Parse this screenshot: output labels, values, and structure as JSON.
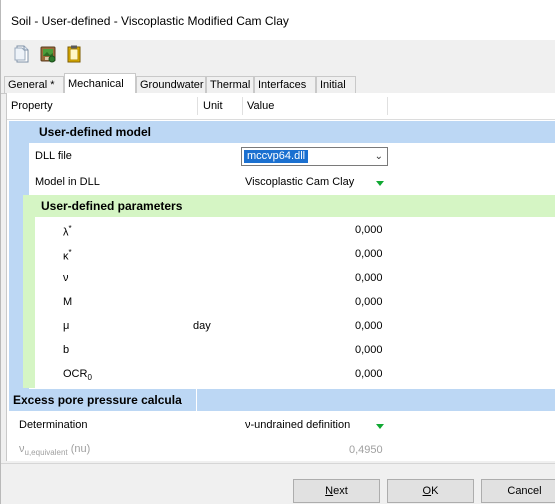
{
  "window": {
    "title": "Soil - User-defined - Viscoplastic Modified Cam Clay"
  },
  "toolbar": {
    "icons": [
      "new-document-icon",
      "save-image-icon",
      "clipboard-icon"
    ]
  },
  "tabs": [
    {
      "label": "General *",
      "active": false
    },
    {
      "label": "Mechanical",
      "active": true
    },
    {
      "label": "Groundwater",
      "active": false
    },
    {
      "label": "Thermal",
      "active": false
    },
    {
      "label": "Interfaces",
      "active": false
    },
    {
      "label": "Initial",
      "active": false
    }
  ],
  "table": {
    "headers": {
      "property": "Property",
      "unit": "Unit",
      "value": "Value"
    },
    "section_user_model": "User-defined model",
    "dll_file": {
      "label": "DLL file",
      "value": "mccvp64.dll"
    },
    "model_in_dll": {
      "label": "Model in DLL",
      "value": "Viscoplastic Cam Clay"
    },
    "section_params": "User-defined parameters",
    "params": [
      {
        "name": "λ",
        "sup": "*",
        "sub": "",
        "unit": "",
        "value": "0,000"
      },
      {
        "name": "κ",
        "sup": "*",
        "sub": "",
        "unit": "",
        "value": "0,000"
      },
      {
        "name": "ν",
        "sup": "",
        "sub": "",
        "unit": "",
        "value": "0,000"
      },
      {
        "name": "M",
        "sup": "",
        "sub": "",
        "unit": "",
        "value": "0,000"
      },
      {
        "name": "μ",
        "sup": "",
        "sub": "",
        "unit": "day",
        "value": "0,000"
      },
      {
        "name": "b",
        "sup": "",
        "sub": "",
        "unit": "",
        "value": "0,000"
      },
      {
        "name": "OCR",
        "sup": "",
        "sub": "0",
        "unit": "",
        "value": "0,000"
      }
    ],
    "section_excess": "Excess pore pressure calcula",
    "determination": {
      "label": "Determination",
      "value": "ν-undrained definition"
    },
    "nu_equiv": {
      "name": "ν",
      "sub": "u,equivalent",
      "suffix": "(nu)",
      "value": "0,4950"
    }
  },
  "buttons": {
    "next": {
      "accel": "N",
      "rest": "ext"
    },
    "ok": {
      "accel": "O",
      "rest": "K"
    },
    "cancel": "Cancel"
  },
  "colors": {
    "section_blue": "#bcd7f4",
    "section_green": "#d5f5c4",
    "selection": "#1b70d0",
    "dropdown_arrow": "#11a833"
  }
}
